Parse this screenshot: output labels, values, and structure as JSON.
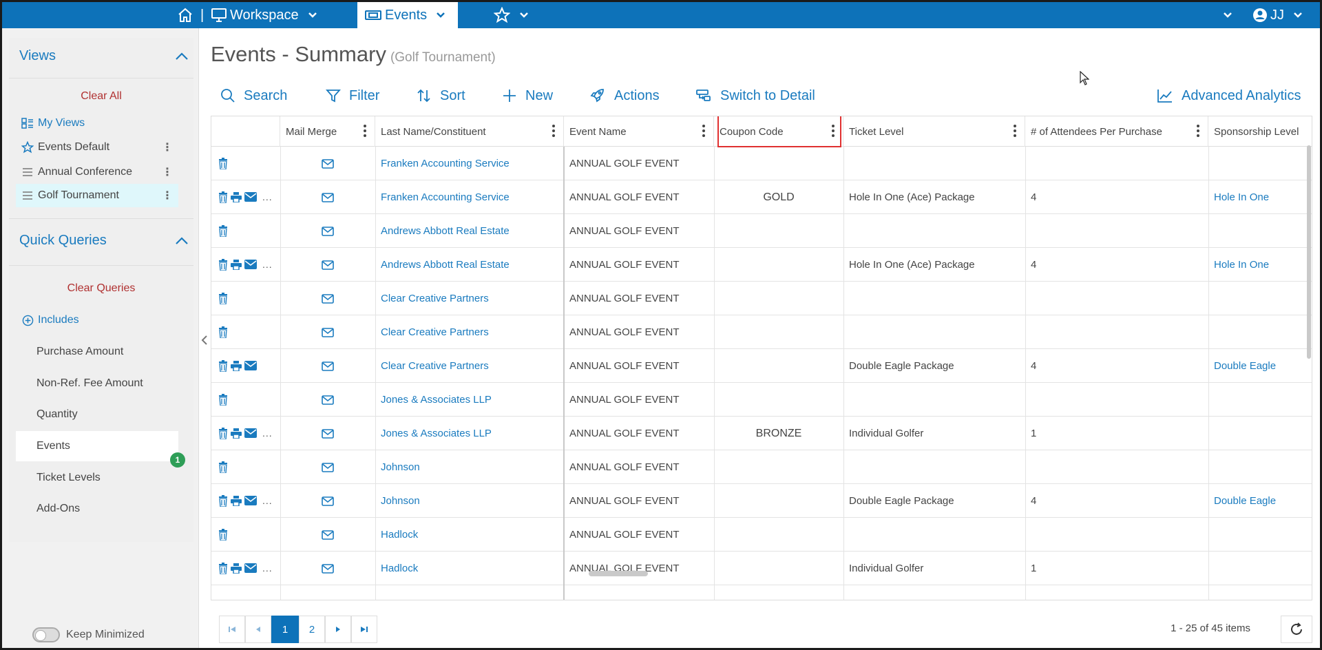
{
  "topbar": {
    "workspace_label": "Workspace",
    "events_label": "Events",
    "separator": "|",
    "user_initials": "JJ"
  },
  "sidebar": {
    "views_title": "Views",
    "clear_all": "Clear All",
    "my_views": "My Views",
    "views": [
      {
        "label": "Events Default"
      },
      {
        "label": "Annual Conference"
      },
      {
        "label": "Golf Tournament"
      }
    ],
    "quick_queries_title": "Quick Queries",
    "clear_queries": "Clear Queries",
    "includes": "Includes",
    "queries": [
      {
        "label": "Purchase Amount"
      },
      {
        "label": "Non-Ref. Fee Amount"
      },
      {
        "label": "Quantity"
      },
      {
        "label": "Events"
      },
      {
        "label": "Ticket Levels"
      },
      {
        "label": "Add-Ons"
      }
    ],
    "events_badge": "1",
    "keep_minimized": "Keep Minimized"
  },
  "page": {
    "title": "Events - Summary",
    "subtitle": "(Golf Tournament)"
  },
  "toolbar": {
    "search": "Search",
    "filter": "Filter",
    "sort": "Sort",
    "new": "New",
    "actions": "Actions",
    "switch": "Switch to Detail",
    "analytics": "Advanced Analytics"
  },
  "grid": {
    "columns": [
      "Mail Merge",
      "Last Name/Constituent",
      "Event Name",
      "Coupon Code",
      "Ticket Level",
      "# of Attendees Per Purchase",
      "Sponsorship Level"
    ],
    "rows": [
      {
        "full": false,
        "name": "Franken Accounting Service",
        "event": "ANNUAL GOLF EVENT",
        "coupon": "",
        "ticket": "",
        "attendees": "",
        "sponsor": ""
      },
      {
        "full": true,
        "name": "Franken Accounting Service",
        "event": "ANNUAL GOLF EVENT",
        "coupon": "GOLD",
        "ticket": "Hole In One (Ace) Package",
        "attendees": "4",
        "sponsor": "Hole In One"
      },
      {
        "full": false,
        "name": "Andrews Abbott Real Estate",
        "event": "ANNUAL GOLF EVENT",
        "coupon": "",
        "ticket": "",
        "attendees": "",
        "sponsor": ""
      },
      {
        "full": true,
        "name": "Andrews Abbott Real Estate",
        "event": "ANNUAL GOLF EVENT",
        "coupon": "",
        "ticket": "Hole In One (Ace) Package",
        "attendees": "4",
        "sponsor": "Hole In One"
      },
      {
        "full": false,
        "name": "Clear Creative Partners",
        "event": "ANNUAL GOLF EVENT",
        "coupon": "",
        "ticket": "",
        "attendees": "",
        "sponsor": ""
      },
      {
        "full": false,
        "name": "Clear Creative Partners",
        "event": "ANNUAL GOLF EVENT",
        "coupon": "",
        "ticket": "",
        "attendees": "",
        "sponsor": ""
      },
      {
        "full": "nodots",
        "name": "Clear Creative Partners",
        "event": "ANNUAL GOLF EVENT",
        "coupon": "",
        "ticket": "Double Eagle Package",
        "attendees": "4",
        "sponsor": "Double Eagle"
      },
      {
        "full": false,
        "name": "Jones & Associates LLP",
        "event": "ANNUAL GOLF EVENT",
        "coupon": "",
        "ticket": "",
        "attendees": "",
        "sponsor": ""
      },
      {
        "full": true,
        "name": "Jones & Associates LLP",
        "event": "ANNUAL GOLF EVENT",
        "coupon": "BRONZE",
        "ticket": "Individual Golfer",
        "attendees": "1",
        "sponsor": ""
      },
      {
        "full": false,
        "name": "Johnson",
        "event": "ANNUAL GOLF EVENT",
        "coupon": "",
        "ticket": "",
        "attendees": "",
        "sponsor": ""
      },
      {
        "full": true,
        "name": "Johnson",
        "event": "ANNUAL GOLF EVENT",
        "coupon": "",
        "ticket": "Double Eagle Package",
        "attendees": "4",
        "sponsor": "Double Eagle"
      },
      {
        "full": false,
        "name": "Hadlock",
        "event": "ANNUAL GOLF EVENT",
        "coupon": "",
        "ticket": "",
        "attendees": "",
        "sponsor": ""
      },
      {
        "full": true,
        "name": "Hadlock",
        "event": "ANNUAL GOLF EVENT",
        "coupon": "",
        "ticket": "Individual Golfer",
        "attendees": "1",
        "sponsor": ""
      }
    ]
  },
  "pager": {
    "pages": [
      "1",
      "2"
    ],
    "current": "1",
    "info": "1 - 25 of 45 items"
  },
  "colors": {
    "brand": "#0d72b9",
    "link": "#1a7bbf",
    "danger": "#b03030",
    "highlight": "#e03030",
    "badge": "#2e9e57"
  }
}
